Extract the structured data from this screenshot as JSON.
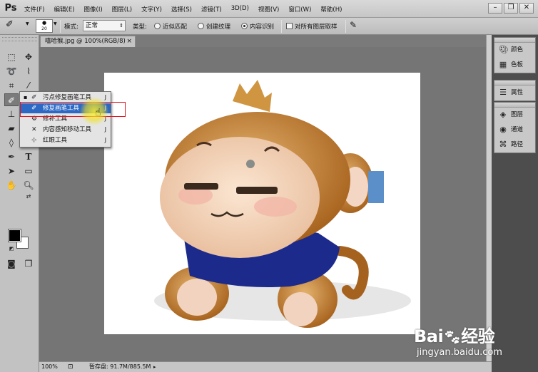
{
  "app": {
    "logo": "Ps"
  },
  "menu": [
    "文件(F)",
    "编辑(E)",
    "图像(I)",
    "图层(L)",
    "文字(Y)",
    "选择(S)",
    "滤镜(T)",
    "3D(D)",
    "视图(V)",
    "窗口(W)",
    "帮助(H)"
  ],
  "window_controls": {
    "minimize": "–",
    "restore": "❐",
    "close": "✕"
  },
  "options": {
    "brush_size": "20",
    "mode_label": "模式:",
    "mode_value": "正常",
    "type_label": "类型:",
    "radio_proximity": "近似匹配",
    "radio_texture": "创建纹理",
    "radio_content_aware": "内容识别",
    "sample_all_layers": "对所有图层取样",
    "selected_type": "内容识别"
  },
  "document": {
    "tab_title": "嘻哈猴.jpg @ 100%(RGB/8)",
    "close": "×"
  },
  "flyout": {
    "items": [
      {
        "label": "污点修复画笔工具",
        "key": "J",
        "icon": "spot-healing-icon",
        "active": true
      },
      {
        "label": "修复画笔工具",
        "key": "J",
        "icon": "healing-brush-icon",
        "highlight": true
      },
      {
        "label": "修补工具",
        "key": "J",
        "icon": "patch-icon"
      },
      {
        "label": "内容感知移动工具",
        "key": "J",
        "icon": "content-aware-move-icon"
      },
      {
        "label": "红眼工具",
        "key": "J",
        "icon": "red-eye-icon"
      }
    ]
  },
  "panels": {
    "group1": [
      {
        "label": "颜色",
        "icon": "palette-icon"
      },
      {
        "label": "色板",
        "icon": "swatches-icon"
      }
    ],
    "group2": [
      {
        "label": "属性",
        "icon": "properties-icon"
      }
    ],
    "group3": [
      {
        "label": "图层",
        "icon": "layers-icon"
      },
      {
        "label": "通道",
        "icon": "channels-icon"
      },
      {
        "label": "路径",
        "icon": "paths-icon"
      }
    ]
  },
  "status": {
    "zoom": "100%",
    "scratch": "暂存盘: 91.7M/885.5M"
  },
  "watermark": {
    "brand": "Bai",
    "brand_cn": "经验",
    "url": "jingyan.baidu.com"
  },
  "colors": {
    "highlight": "#2c68c4",
    "red_box": "#e0141e",
    "foreground": "#000000",
    "background": "#ffffff"
  }
}
